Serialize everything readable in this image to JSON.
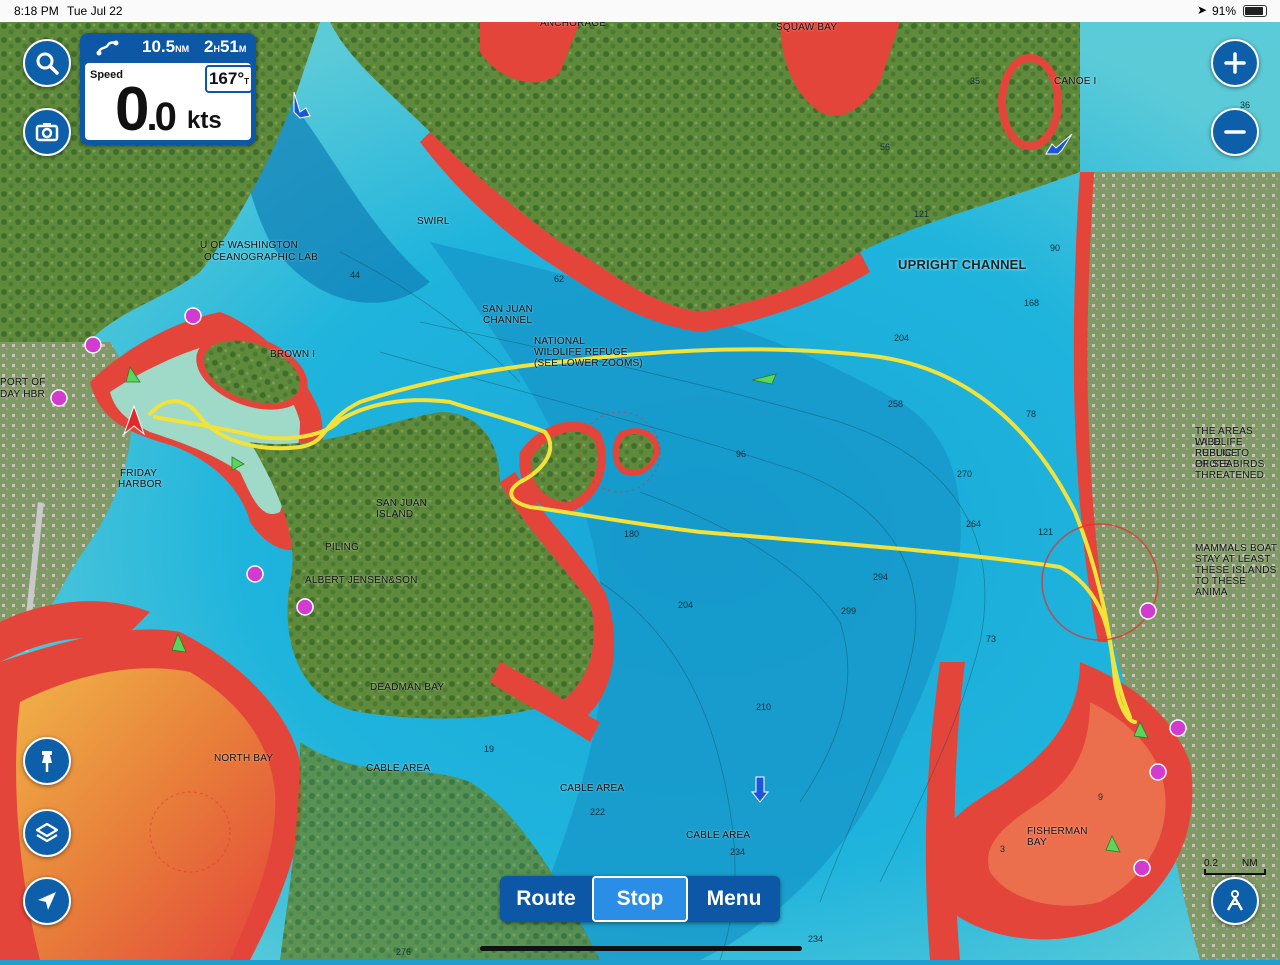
{
  "status_bar": {
    "time": "8:18 PM",
    "date": "Tue Jul 22",
    "battery": "91%",
    "battery_level": 0.91
  },
  "info_panel": {
    "distance_value": "10.5",
    "distance_unit": "NM",
    "eta_hours": "2",
    "eta_hours_unit": "H",
    "eta_minutes": "51",
    "eta_minutes_unit": "M",
    "speed_label": "Speed",
    "speed_int": "0",
    "speed_dec": ".0",
    "speed_unit": "kts",
    "heading_value": "167°",
    "heading_unit": "T"
  },
  "bottom_bar": {
    "route_label": "Route",
    "stop_label": "Stop",
    "menu_label": "Menu"
  },
  "scale": {
    "value": "0.2",
    "unit": "NM"
  },
  "map_labels": {
    "squaw_bay": "SQUAW BAY",
    "anchorage": "ANCHORAGE",
    "uow": "U OF WASHINGTON",
    "ocean_lab": "OCEANOGRAPHIC LAB",
    "swirl": "SWIRL",
    "upright_channel": "UPRIGHT CHANNEL",
    "canoe": "CANOE I",
    "san_juan_channel_1": "SAN JUAN",
    "san_juan_channel_2": "CHANNEL",
    "nwr_1": "NATIONAL",
    "nwr_2": "WILDLIFE REFUGE",
    "nwr_3": "(SEE LOWER ZOOMS)",
    "brown_island": "BROWN I",
    "port_of": "PORT OF",
    "friday_hbr_short": "DAY HBR",
    "friday_harbor_1": "FRIDAY",
    "friday_harbor_2": "HARBOR",
    "san_juan_island_1": "SAN JUAN",
    "san_juan_island_2": "ISLAND",
    "piling": "PILING",
    "albert_jensen": "ALBERT JENSEN&SON",
    "deadman_bay": "DEADMAN BAY",
    "north_bay": "NORTH BAY",
    "cable_area_1": "CABLE AREA",
    "cable_area_2": "CABLE AREA",
    "cable_area_3": "CABLE AREA",
    "fisherman_bay_1": "FISHERMAN",
    "fisherman_bay_2": "BAY",
    "note1_1": "THE AREAS LABE",
    "note1_2": "WILDLIFE REFUGE",
    "note1_3": "PUBLIC TO PROTE",
    "note1_4": "OF SEABIRDS",
    "note1_5": "THREATENED",
    "note2_1": "MAMMALS BOAT",
    "note2_2": "STAY AT LEAST",
    "note2_3": "THESE ISLANDS T",
    "note2_4": "TO THESE ANIMA"
  },
  "depth_soundings": [
    "35",
    "36",
    "56",
    "121",
    "90",
    "168",
    "204",
    "258",
    "270",
    "264",
    "121",
    "78",
    "294",
    "299",
    "204",
    "210",
    "222",
    "234",
    "276",
    "234",
    "73",
    "96",
    "180",
    "44",
    "62",
    "19",
    "3",
    "9"
  ],
  "icons": {
    "search": "search-icon",
    "camera": "camera-icon",
    "zoom_in": "plus-icon",
    "zoom_out": "minus-icon",
    "pin": "pin-icon",
    "layers": "layers-icon",
    "locate": "location-arrow-icon",
    "person": "person-overboard-icon",
    "route": "route-icon"
  },
  "colors": {
    "accent": "#0d58a6",
    "active_button": "#2a8ee6",
    "track": "#f2e23a",
    "shallow": "#e8463c",
    "deep": "#1e9fd0",
    "land": "#5f8a3c"
  }
}
